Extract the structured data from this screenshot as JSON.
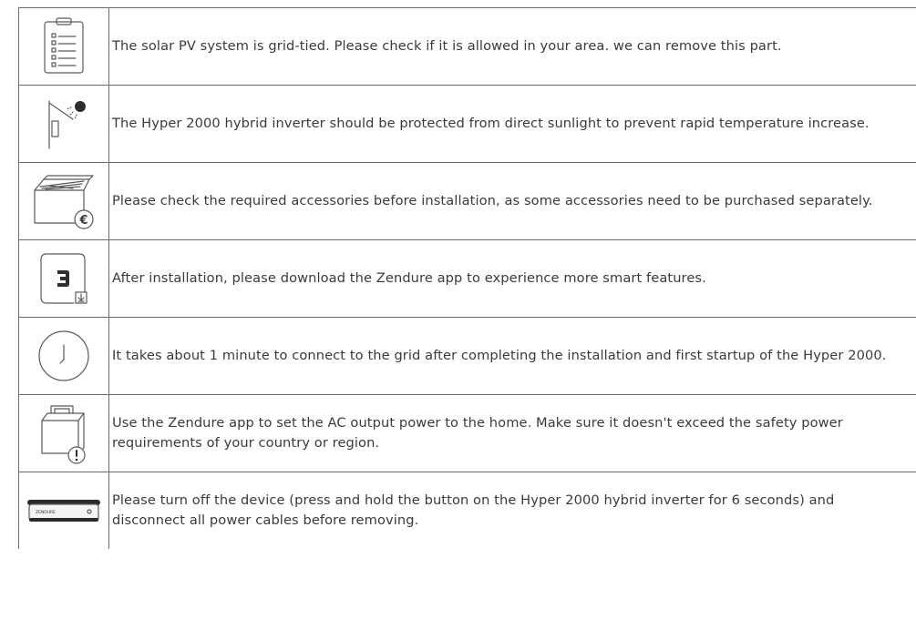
{
  "rows": [
    {
      "icon": "checklist-clipboard-icon",
      "text": "The solar PV system is grid-tied. Please check if it is allowed in your area. we can remove this part."
    },
    {
      "icon": "sun-wall-shade-icon",
      "text": "The Hyper 2000 hybrid inverter should be protected from direct sunlight to prevent rapid temperature increase."
    },
    {
      "icon": "box-euro-icon",
      "text": "Please check the required accessories before installation, as some accessories need to be purchased separately."
    },
    {
      "icon": "zendure-app-download-icon",
      "text": "After installation, please download the Zendure app to experience more smart features."
    },
    {
      "icon": "clock-icon",
      "text": "It takes about 1 minute to connect to the grid after completing the installation and first startup of the Hyper 2000."
    },
    {
      "icon": "inverter-warning-icon",
      "text": "Use the Zendure app to set the AC output power to the home. Make sure it doesn't exceed the safety power requirements of your country or region."
    },
    {
      "icon": "hyper-2000-device-icon",
      "device_label": "ZENDURE",
      "text": "Please turn off the device (press and hold the button on the Hyper 2000 hybrid inverter for 6 seconds) and disconnect all power cables  before removing."
    }
  ]
}
